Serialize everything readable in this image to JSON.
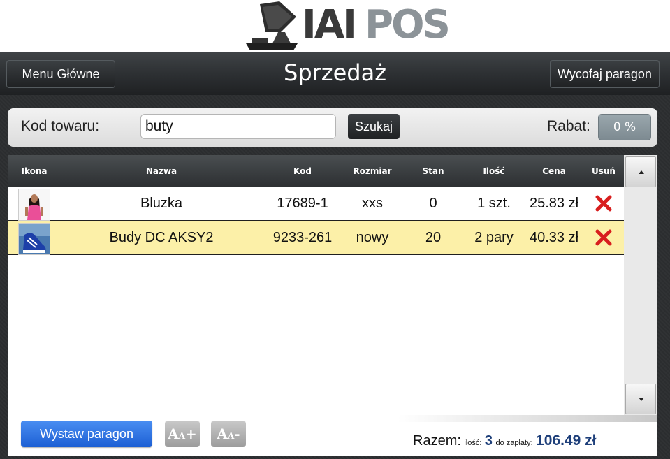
{
  "logo": {
    "part1": "IAI",
    "part2": "POS"
  },
  "header": {
    "title": "Sprzedaż",
    "menu_label": "Menu Główne",
    "withdraw_label": "Wycofaj paragon"
  },
  "search": {
    "code_label": "Kod towaru:",
    "value": "buty",
    "button_label": "Szukaj",
    "discount_label": "Rabat:",
    "discount_value": "0 %"
  },
  "table": {
    "columns": [
      "Ikona",
      "Nazwa",
      "Kod",
      "Rozmiar",
      "Stan",
      "Ilość",
      "Cena",
      "Usuń"
    ],
    "rows": [
      {
        "icon": "product-thumb-woman-pink-blouse",
        "name": "Bluzka",
        "code": "17689-1",
        "size": "xxs",
        "stock": "0",
        "qty": "1 szt.",
        "price": "25.83 zł",
        "selected": false
      },
      {
        "icon": "product-thumb-blue-shoe",
        "name": "Budy DC AKSY2",
        "code": "9233-261",
        "size": "nowy",
        "stock": "20",
        "qty": "2 pary",
        "price": "40.33 zł",
        "selected": true
      }
    ]
  },
  "footer": {
    "issue_label": "Wystaw paragon",
    "font_increase": {
      "big": "A",
      "small": "A",
      "sign": "+"
    },
    "font_decrease": {
      "big": "A",
      "small": "A",
      "sign": "-"
    },
    "total_label": "Razem:",
    "qty_label": "ilość:",
    "qty_value": "3",
    "pay_label": "do zapłaty:",
    "pay_value": "106.49 zł"
  },
  "colors": {
    "selected_row": "#fcf0a8",
    "primary_button": "#2a6fe0",
    "delete_icon": "#d81e1e",
    "total_text": "#1e3f7a"
  }
}
